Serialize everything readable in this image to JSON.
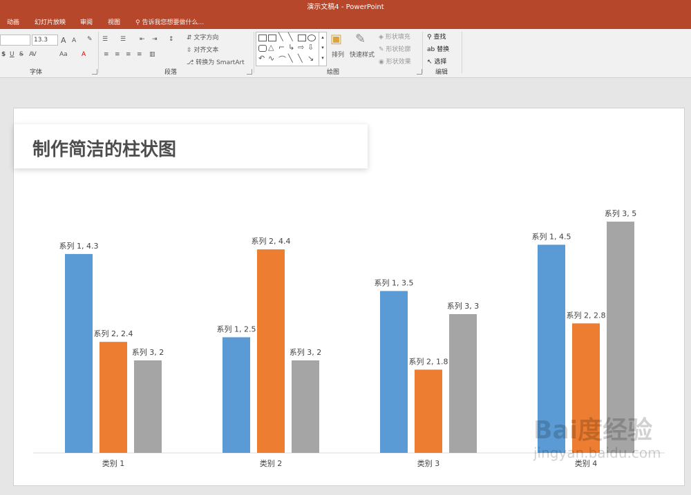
{
  "window": {
    "title": "演示文稿4 - PowerPoint"
  },
  "tabs": [
    "动画",
    "幻灯片放映",
    "审阅",
    "视图"
  ],
  "tellme": "告诉我您想要做什么...",
  "ribbon": {
    "font": {
      "size": "13.3",
      "group_label": "字体",
      "grow": "A",
      "shrink": "A",
      "aa": "Aa",
      "underline": "U",
      "strike": "S",
      "clear": "A"
    },
    "paragraph": {
      "group_label": "段落",
      "text_direction": "文字方向",
      "align_text": "对齐文本",
      "convert_smartart": "转换为 SmartArt"
    },
    "drawing": {
      "group_label": "绘图",
      "arrange": "排列",
      "quick_styles": "快速样式",
      "shape_fill": "形状填充",
      "shape_outline": "形状轮廓",
      "shape_effects": "形状效果"
    },
    "editing": {
      "group_label": "编辑",
      "find": "查找",
      "replace": "替换",
      "select": "选择"
    }
  },
  "slide": {
    "title": "制作简洁的柱状图"
  },
  "watermark": {
    "line1": "Bai度经验",
    "line2": "jingyan.baidu.com"
  },
  "chart_data": {
    "type": "bar",
    "categories": [
      "类别 1",
      "类别 2",
      "类别 3",
      "类别 4"
    ],
    "series": [
      {
        "name": "系列 1",
        "values": [
          4.3,
          2.5,
          3.5,
          4.5
        ],
        "color": "#5b9bd5"
      },
      {
        "name": "系列 2",
        "values": [
          2.4,
          4.4,
          1.8,
          2.8
        ],
        "color": "#ed7d31"
      },
      {
        "name": "系列 3",
        "values": [
          2,
          2,
          3,
          5
        ],
        "color": "#a5a5a5"
      }
    ],
    "data_labels": [
      [
        "系列 1, 4.3",
        "系列 1, 2.5",
        "系列 1, 3.5",
        "系列 1, 4.5"
      ],
      [
        "系列 2, 2.4",
        "系列 2, 4.4",
        "系列 2, 1.8",
        "系列 2, 2.8"
      ],
      [
        "系列 3, 2",
        "系列 3, 2",
        "系列 3, 3",
        "系列 3, 5"
      ]
    ],
    "ylim": [
      0,
      5
    ],
    "grid": false,
    "legend": "none"
  }
}
